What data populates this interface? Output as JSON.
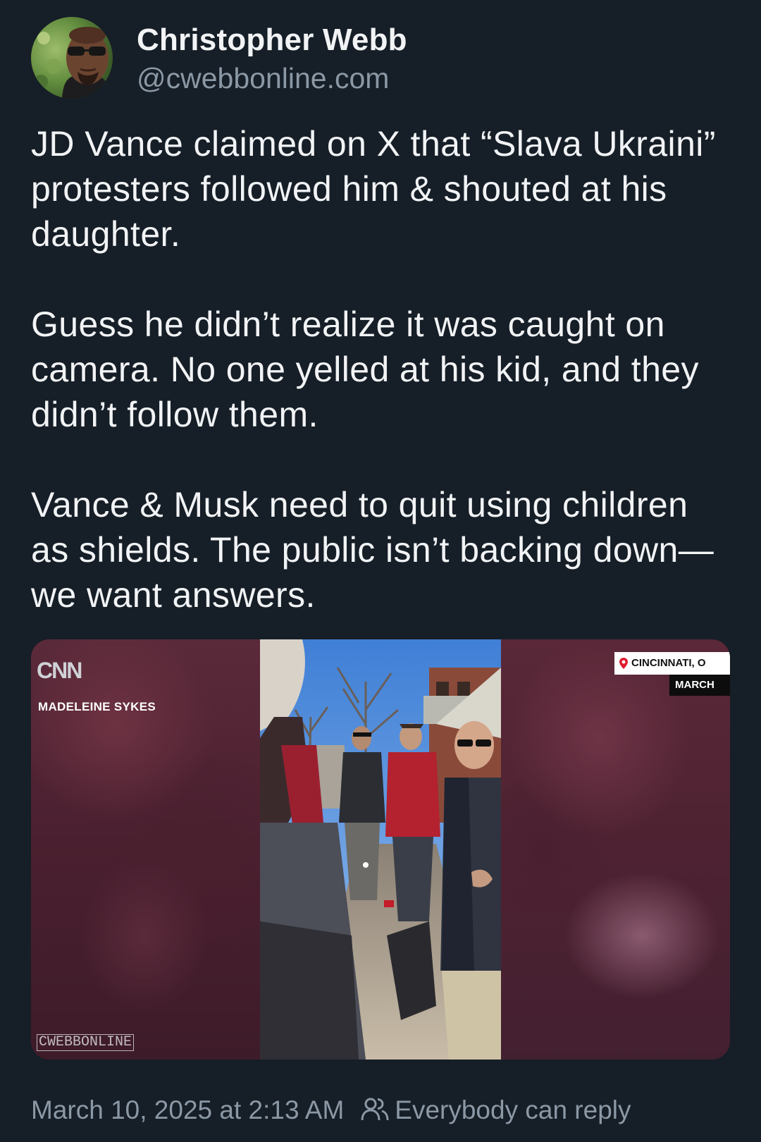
{
  "author": {
    "display_name": "Christopher Webb",
    "handle": "@cwebbonline.com"
  },
  "post": {
    "paragraphs": [
      "JD Vance claimed on X that “Slava Ukraini” protesters followed him & shouted at his daughter.",
      "Guess he didn’t realize it was caught on camera. No one yelled at his kid, and they didn’t follow them.",
      "Vance & Musk need to quit using children as shields. The public isn’t backing down—we want answers."
    ],
    "timestamp": "March 10, 2025 at 2:13 AM",
    "reply_setting": "Everybody can reply"
  },
  "media": {
    "network_logo": "CNN",
    "reporter_name": "MADELEINE SYKES",
    "location_label": "CINCINNATI, O",
    "date_label": "MARCH",
    "watermark": "CWEBBONLINE"
  },
  "icons": {
    "location": "map-pin-icon",
    "reply_audience": "people-icon"
  },
  "colors": {
    "background": "#161e27",
    "primary_text": "#f1f3f5",
    "secondary_text": "#8b98a5",
    "location_pin": "#e01c2f"
  }
}
